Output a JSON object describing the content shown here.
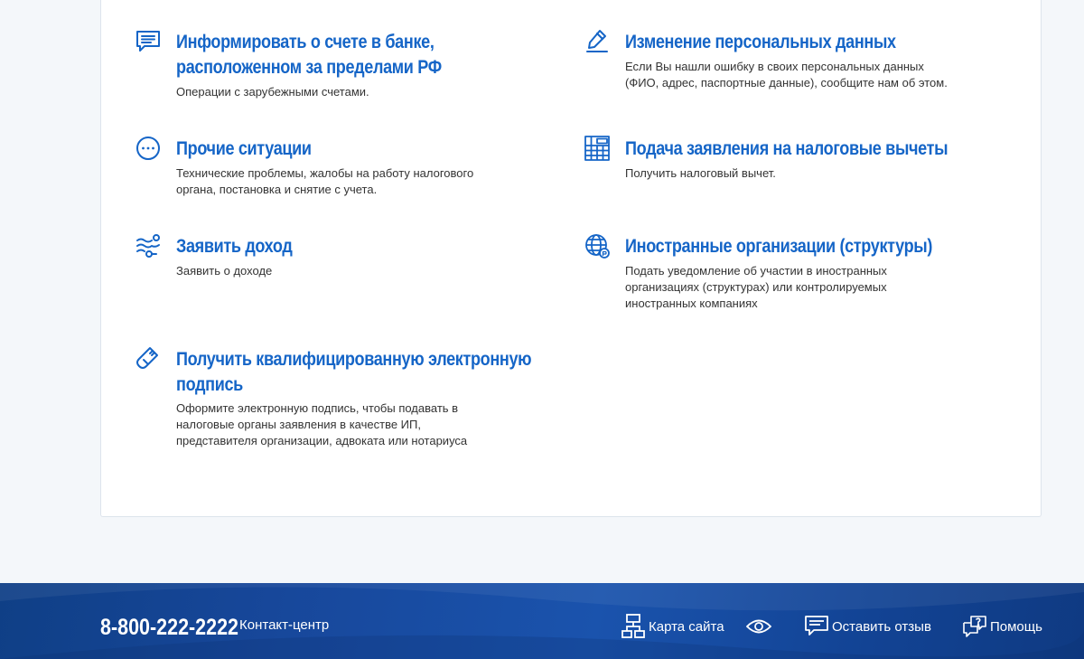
{
  "services": [
    {
      "title_lines": [
        "Информировать о счете в банке,",
        "расположенном за пределами РФ"
      ],
      "desc_lines": [
        "Операции с зарубежными счетами."
      ],
      "icon": "message-list-icon"
    },
    {
      "title_lines": [
        "Изменение персональных данных"
      ],
      "desc_lines": [
        "Если Вы нашли ошибку в своих персональных данных",
        "(ФИО, адрес, паспортные данные), сообщите нам об этом."
      ],
      "icon": "pencil-icon"
    },
    {
      "title_lines": [
        "Прочие ситуации"
      ],
      "desc_lines": [
        "Технические проблемы, жалобы на работу налогового",
        "органа, постановка и снятие с учета."
      ],
      "icon": "dots-circle-icon"
    },
    {
      "title_lines": [
        "Подача заявления на налоговые вычеты"
      ],
      "desc_lines": [
        "Получить налоговый вычет."
      ],
      "icon": "calculator-icon"
    },
    {
      "title_lines": [
        "Заявить доход"
      ],
      "desc_lines": [
        "Заявить о доходе"
      ],
      "icon": "income-flow-icon"
    },
    {
      "title_lines": [
        "Иностранные организации (структуры)"
      ],
      "desc_lines": [
        "Подать уведомление об участии в иностранных",
        "организациях (структурах) или контролируемых",
        "иностранных компаниях"
      ],
      "icon": "globe-icon"
    },
    {
      "title_lines": [
        "Получить квалифицированную электронную",
        "подпись"
      ],
      "desc_lines": [
        "Оформите электронную подпись, чтобы подавать в",
        "налоговые органы заявления в качестве ИП,",
        "представителя организации, адвоката или нотариуса"
      ],
      "icon": "usb-token-icon"
    }
  ],
  "footer": {
    "phone": "8-800-222-2222",
    "contact_center": "Контакт-центр",
    "sitemap": "Карта сайта",
    "feedback": "Оставить отзыв",
    "help": "Помощь"
  },
  "colors": {
    "accent": "#1565c7",
    "footer": "#17479a",
    "text": "#333333"
  }
}
